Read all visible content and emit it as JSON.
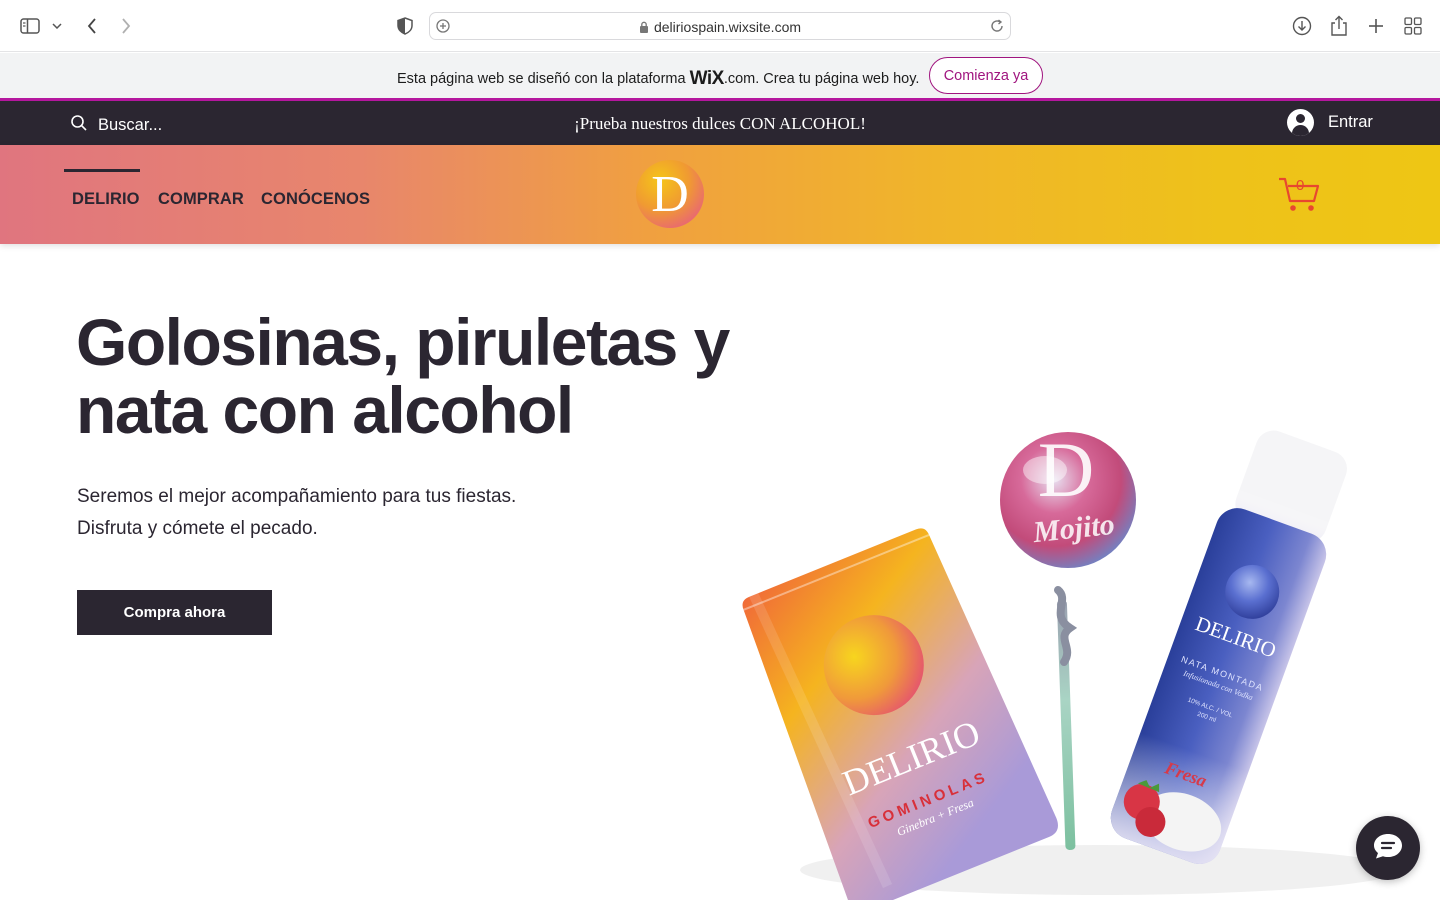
{
  "browser": {
    "url": "deliriospain.wixsite.com"
  },
  "wix_banner": {
    "text_before": "Esta página web se diseñó con la plataforma ",
    "brand": "WiX",
    "text_after": ".com. Crea tu página web hoy.",
    "button_label": "Comienza ya"
  },
  "topbar": {
    "search_placeholder": "Buscar...",
    "promo": "¡Prueba nuestros dulces CON ALCOHOL!",
    "login_label": "Entrar"
  },
  "nav": {
    "items": [
      {
        "label": "DELIRIO",
        "active": true
      },
      {
        "label": "COMPRAR"
      },
      {
        "label": "CONÓCENOS"
      }
    ],
    "logo_letter": "D",
    "cart_count": "0"
  },
  "hero": {
    "title_line1": "Golosinas, piruletas y",
    "title_line2": "nata con alcohol",
    "subtitle_line1": "Seremos el mejor acompañamiento para tus fiestas.",
    "subtitle_line2": "Disfruta y cómete el pecado.",
    "cta_label": "Compra ahora"
  },
  "products": {
    "bag": {
      "brand": "DELIRIO",
      "name": "GOMINOLAS",
      "flavor": "Ginebra + Fresa"
    },
    "lollipop": {
      "letter": "D",
      "flavor": "Mojito"
    },
    "can": {
      "brand": "DELIRIO",
      "name": "NATA MONTADA",
      "desc": "Infusionada con Vodka",
      "alc": "10% ALC. / VOL",
      "vol": "200 ml",
      "flavor": "Fresa"
    }
  },
  "colors": {
    "dark": "#2b2631",
    "wix_accent": "#b5179e",
    "cart_accent": "#e8472f"
  }
}
